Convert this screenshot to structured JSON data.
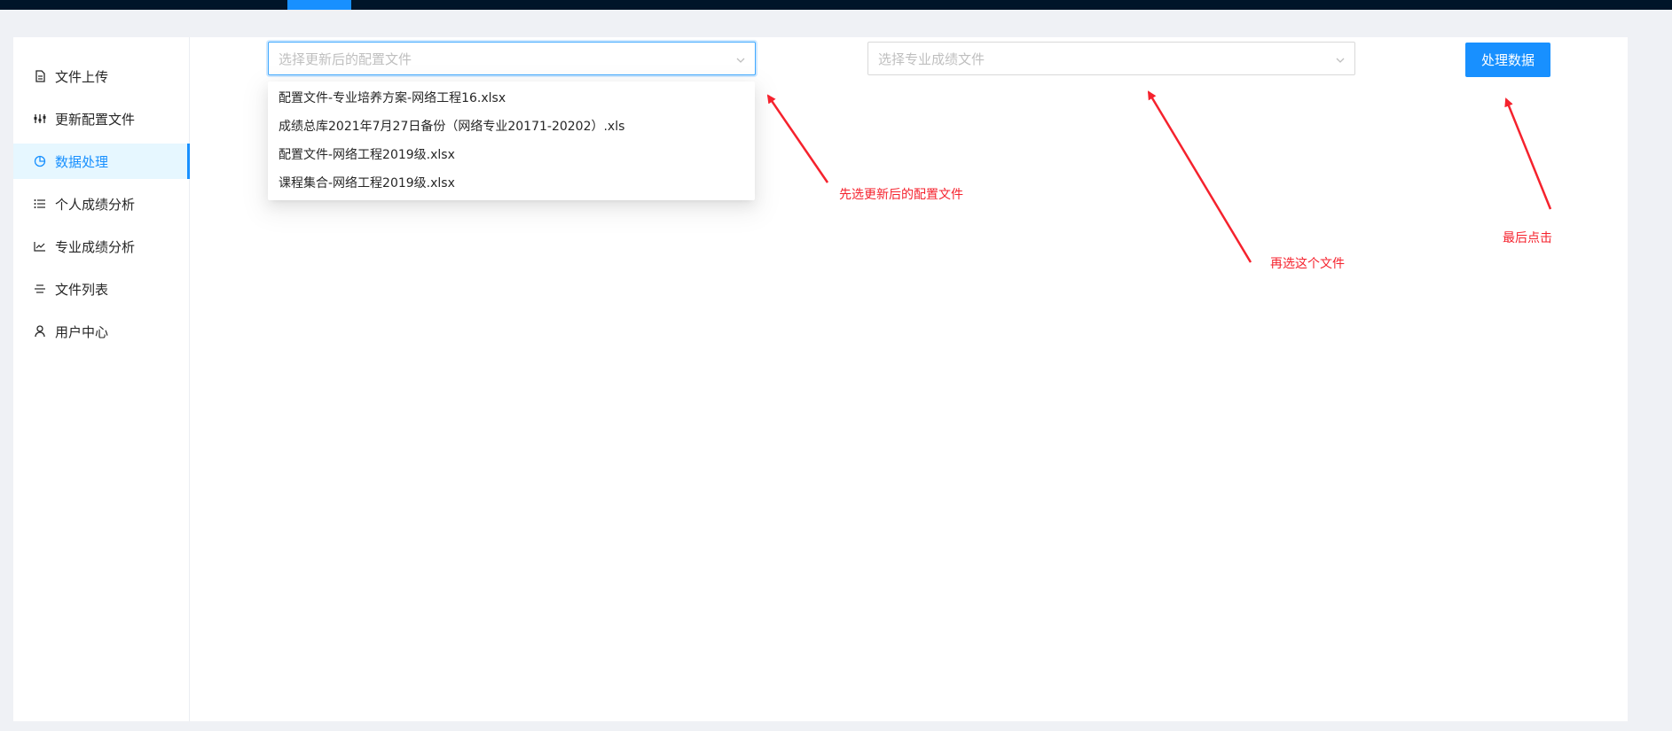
{
  "sidebar": {
    "items": [
      {
        "label": "文件上传",
        "icon": "file-icon"
      },
      {
        "label": "更新配置文件",
        "icon": "sliders-icon"
      },
      {
        "label": "数据处理",
        "icon": "pie-chart-icon"
      },
      {
        "label": "个人成绩分析",
        "icon": "list-icon"
      },
      {
        "label": "专业成绩分析",
        "icon": "line-chart-icon"
      },
      {
        "label": "文件列表",
        "icon": "menu-icon"
      },
      {
        "label": "用户中心",
        "icon": "user-icon"
      }
    ],
    "active_index": 2
  },
  "config_select": {
    "placeholder": "选择更新后的配置文件",
    "options": [
      "配置文件-专业培养方案-网络工程16.xlsx",
      "成绩总库2021年7月27日备份（网络专业20171-20202）.xls",
      "配置文件-网络工程2019级.xlsx",
      "课程集合-网络工程2019级.xlsx"
    ]
  },
  "grades_select": {
    "placeholder": "选择专业成绩文件"
  },
  "process_button": {
    "label": "处理数据"
  },
  "annotations": {
    "step1": "先选更新后的配置文件",
    "step2": "再选这个文件",
    "step3": "最后点击"
  },
  "colors": {
    "accent": "#1890ff",
    "topbar": "#001529",
    "annotation": "#f5222d",
    "active_bg": "#e6f7ff"
  }
}
